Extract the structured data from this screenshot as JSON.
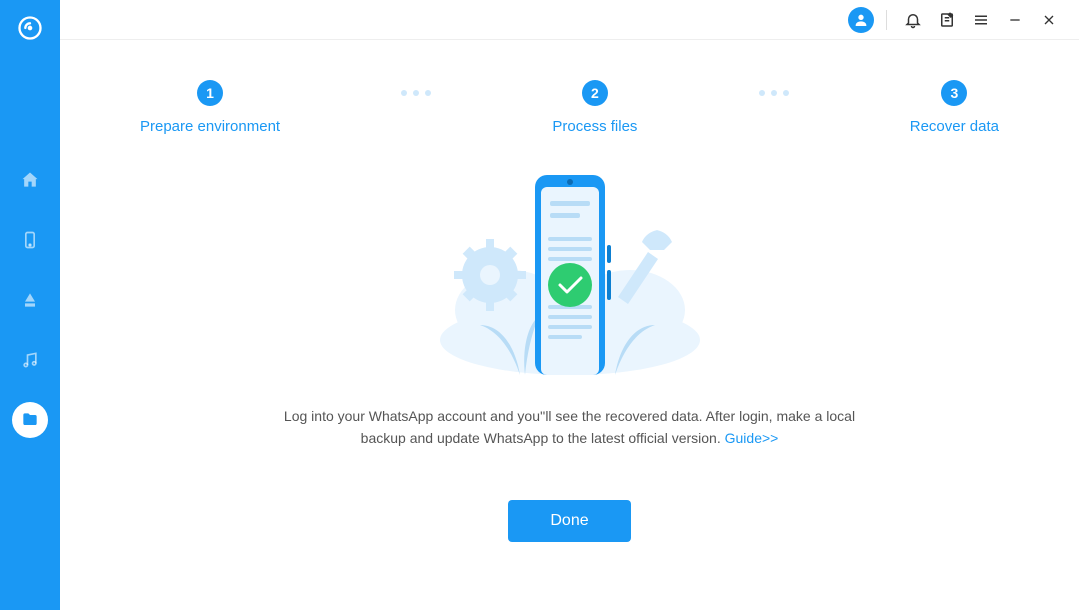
{
  "sidebar": {
    "items": [
      {
        "name": "home"
      },
      {
        "name": "phone"
      },
      {
        "name": "cloud"
      },
      {
        "name": "music"
      },
      {
        "name": "folder",
        "active": true
      }
    ]
  },
  "steps": [
    {
      "num": "1",
      "label": "Prepare environment"
    },
    {
      "num": "2",
      "label": "Process files"
    },
    {
      "num": "3",
      "label": "Recover data"
    }
  ],
  "instruction": {
    "text1": "Log into your WhatsApp account and you''ll see the recovered data. After login, make a local backup and update WhatsApp to the latest official version. ",
    "guide_label": "Guide>>"
  },
  "buttons": {
    "done": "Done"
  }
}
